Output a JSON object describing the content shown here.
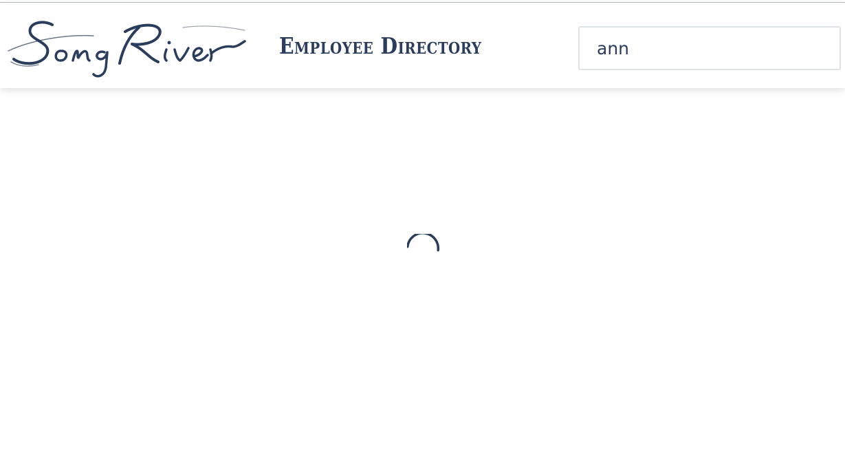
{
  "brand": {
    "logo_text": "SongRiver",
    "color": "#2b3d5c"
  },
  "header": {
    "title": "Employee Directory"
  },
  "search": {
    "value": "ann",
    "icon": "none"
  },
  "main": {
    "loading": true,
    "spinner_icon": "loading-spinner-icon"
  }
}
